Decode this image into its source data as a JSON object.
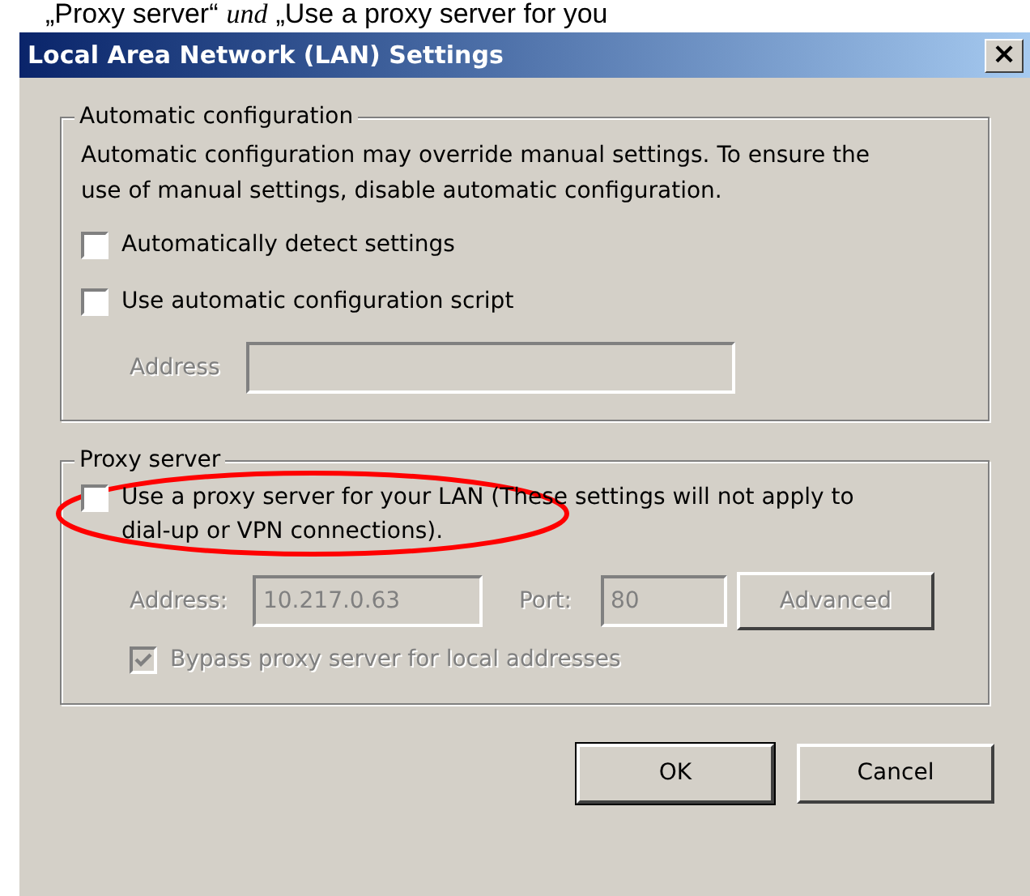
{
  "caption": {
    "parts": [
      {
        "text": "„Proxy server“",
        "italic": false
      },
      {
        "text": "und",
        "italic": true
      },
      {
        "text": "„Use a proxy server for you",
        "italic": false
      }
    ]
  },
  "window": {
    "title": "Local Area Network (LAN) Settings",
    "close": "×"
  },
  "automatic": {
    "legend": "Automatic configuration",
    "description": "Automatic configuration may override manual settings.  To ensure the use of manual settings, disable automatic configuration.",
    "options": [
      {
        "label": "Automatically detect settings",
        "checked": false,
        "disabled": false
      },
      {
        "label": "Use automatic configuration script",
        "checked": false,
        "disabled": false
      }
    ],
    "address": {
      "label": "Address",
      "disabled": true
    }
  },
  "proxy": {
    "legend": "Proxy server",
    "use_proxy": {
      "label": "Use a proxy server for your LAN (These settings will not apply to dial-up or VPN connections).",
      "checked": false,
      "disabled": false,
      "annotated": true
    },
    "address": {
      "label": "Address:",
      "value": "10.217.0.63",
      "disabled": true
    },
    "port": {
      "label": "Port:",
      "value": "80",
      "disabled": true
    },
    "advanced": {
      "label": "Advanced",
      "disabled": true
    },
    "bypass": {
      "label": "Bypass proxy server for local addresses",
      "checked": true,
      "disabled": true
    }
  },
  "buttons": [
    {
      "label": "OK",
      "default": true
    },
    {
      "label": "Cancel",
      "default": false
    }
  ]
}
